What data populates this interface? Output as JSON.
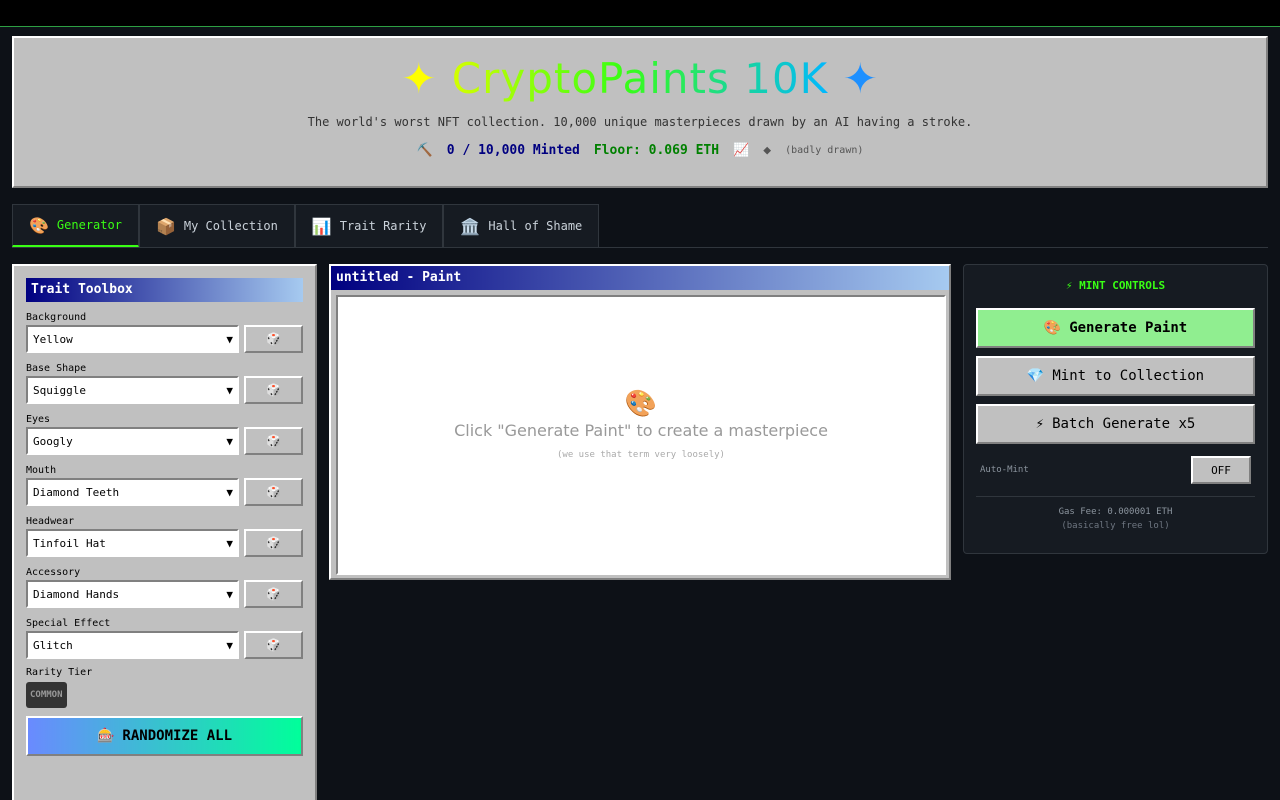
{
  "header": {
    "spark_left": "✦",
    "title": "CryptoPaints 10K",
    "spark_right": "✦",
    "subtitle": "The world's worst NFT collection. 10,000 unique masterpieces drawn by an AI having a stroke.",
    "minted_icon": "⛏️",
    "minted": "0 / 10,000 Minted",
    "floor": "Floor: 0.069 ETH",
    "chart_icon": "📈",
    "diamond": "◆",
    "badly": "(badly drawn)"
  },
  "tabs": [
    {
      "icon": "🎨",
      "label": "Generator"
    },
    {
      "icon": "📦",
      "label": "My Collection"
    },
    {
      "icon": "📊",
      "label": "Trait Rarity"
    },
    {
      "icon": "🏛️",
      "label": "Hall of Shame"
    }
  ],
  "toolbox": {
    "title": "Trait Toolbox",
    "dice_icon": "🎲",
    "traits": [
      {
        "label": "Background",
        "value": "Yellow"
      },
      {
        "label": "Base Shape",
        "value": "Squiggle"
      },
      {
        "label": "Eyes",
        "value": "Googly"
      },
      {
        "label": "Mouth",
        "value": "Diamond Teeth"
      },
      {
        "label": "Headwear",
        "value": "Tinfoil Hat"
      },
      {
        "label": "Accessory",
        "value": "Diamond Hands"
      },
      {
        "label": "Special Effect",
        "value": "Glitch"
      }
    ],
    "rarity_label": "Rarity Tier",
    "rarity_value": "COMMON",
    "randomize_icon": "🎰",
    "randomize_label": "RANDOMIZE ALL"
  },
  "paint": {
    "title": "untitled - Paint",
    "icon": "🎨",
    "message": "Click \"Generate Paint\" to create a masterpiece",
    "sub": "(we use that term very loosely)"
  },
  "mint": {
    "header_icon": "⚡",
    "header": "MINT CONTROLS",
    "generate_icon": "🎨",
    "generate": "Generate Paint",
    "mint_icon": "💎",
    "mint_label": "Mint to Collection",
    "batch_icon": "⚡",
    "batch": "Batch Generate x5",
    "automint_label": "Auto-Mint",
    "automint_value": "OFF",
    "gas": "Gas Fee: 0.000001 ETH",
    "gas_note": "(basically free lol)"
  }
}
